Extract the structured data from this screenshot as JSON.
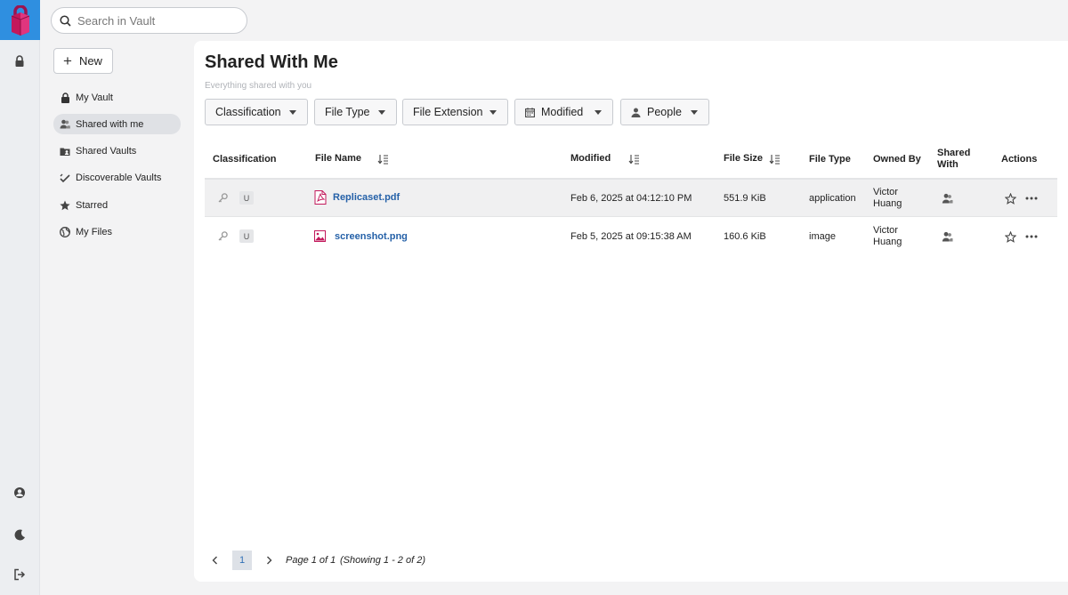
{
  "search": {
    "placeholder": "Search in Vault"
  },
  "sidebar": {
    "new_label": "New",
    "items": [
      {
        "label": "My Vault",
        "icon": "lock-icon"
      },
      {
        "label": "Shared with me",
        "icon": "people-icon",
        "active": true
      },
      {
        "label": "Shared Vaults",
        "icon": "shared-folder-icon"
      },
      {
        "label": "Discoverable Vaults",
        "icon": "discover-icon"
      },
      {
        "label": "Starred",
        "icon": "star-icon"
      },
      {
        "label": "My Files",
        "icon": "globe-icon"
      }
    ]
  },
  "page": {
    "title": "Shared With Me",
    "subtitle": "Everything shared with you"
  },
  "filters": [
    {
      "label": "Classification"
    },
    {
      "label": "File Type"
    },
    {
      "label": "File Extension"
    },
    {
      "label": "Modified",
      "icon": "calendar-icon"
    },
    {
      "label": "People",
      "icon": "person-icon"
    }
  ],
  "table": {
    "columns": [
      "Classification",
      "File Name",
      "Modified",
      "File Size",
      "File Type",
      "Owned By",
      "Shared With",
      "Actions"
    ],
    "rows": [
      {
        "badge": "U",
        "name": "Replicaset.pdf",
        "file_icon": "pdf-icon",
        "modified": "Feb 6, 2025 at 04:12:10 PM",
        "size": "551.9 KiB",
        "type": "application",
        "owner": "Victor Huang"
      },
      {
        "badge": "U",
        "name": "screenshot.png",
        "file_icon": "image-icon",
        "modified": "Feb 5, 2025 at 09:15:38 AM",
        "size": "160.6 KiB",
        "type": "image",
        "owner": "Victor Huang"
      }
    ]
  },
  "pagination": {
    "current_page": "1",
    "page_of": "Page 1 of 1",
    "showing": "(Showing 1 - 2 of 2)"
  },
  "colors": {
    "accent": "#2f8fe0",
    "link": "#2561a8",
    "logo": "#c2185b"
  }
}
